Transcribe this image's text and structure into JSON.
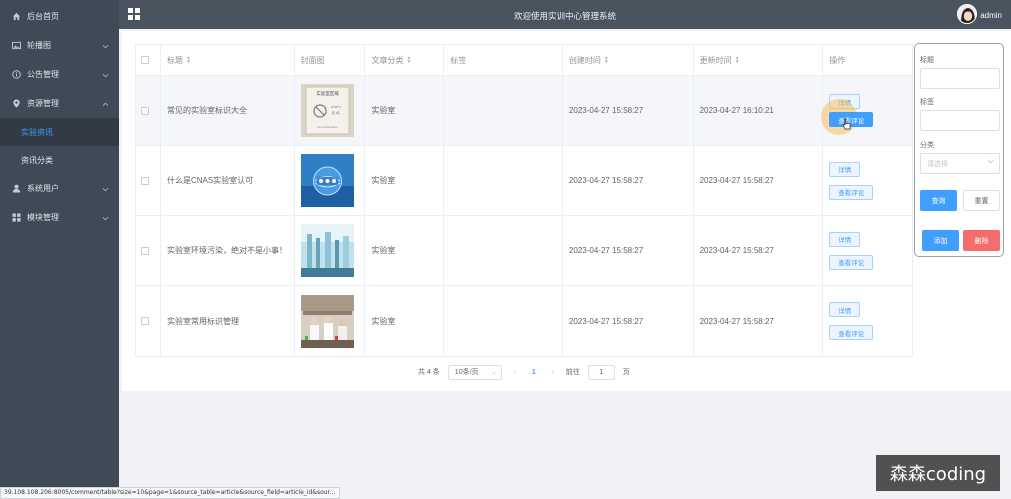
{
  "sidebar": {
    "items": [
      {
        "label": "后台首页",
        "icon": "home-icon"
      },
      {
        "label": "轮播图",
        "icon": "image-icon"
      },
      {
        "label": "公告管理",
        "icon": "info-circle-icon"
      },
      {
        "label": "资源管理",
        "icon": "location-icon",
        "expanded": true
      },
      {
        "label": "系统用户",
        "icon": "user-icon"
      },
      {
        "label": "模块管理",
        "icon": "grid-icon"
      }
    ],
    "subitems": [
      {
        "label": "实验资讯",
        "active": true
      },
      {
        "label": "资讯分类"
      }
    ]
  },
  "header": {
    "title": "欢迎使用实训中心管理系统",
    "user": "admin"
  },
  "table": {
    "columns": [
      "标题",
      "封面图",
      "文章分类",
      "标签",
      "创建时间",
      "更新时间",
      "操作"
    ],
    "rows": [
      {
        "title": "常见的实验室标识大全",
        "category": "实验室",
        "tag": "",
        "created": "2023-04-27 15:58:27",
        "updated": "2023-04-27 16:10:21",
        "cover": "sign-image"
      },
      {
        "title": "什么是CNAS实验室认可",
        "category": "实验室",
        "tag": "",
        "created": "2023-04-27 15:58:27",
        "updated": "2023-04-27 15:58:27",
        "cover": "cnas-image"
      },
      {
        "title": "实验室环境污染，绝对不是小事！",
        "category": "实验室",
        "tag": "",
        "created": "2023-04-27 15:58:27",
        "updated": "2023-04-27 15:58:27",
        "cover": "lab-equipment-image"
      },
      {
        "title": "实验室常用标识管理",
        "category": "实验室",
        "tag": "",
        "created": "2023-04-27 15:58:27",
        "updated": "2023-04-27 15:58:27",
        "cover": "lab-people-image"
      }
    ],
    "detail_label": "详情",
    "comments_label": "查看评论",
    "cover_sign_text": [
      "实验室区域",
      "A7OF 4",
      "区-1区",
      "Lave & Reindane"
    ]
  },
  "pagination": {
    "total": "共 4 条",
    "page_size": "10条/页",
    "prev": "‹",
    "current": "1",
    "next": "›",
    "goto_prefix": "前往",
    "goto_value": "1",
    "goto_suffix": "页"
  },
  "filter": {
    "title_label": "标题",
    "tag_label": "标签",
    "category_label": "分类",
    "category_placeholder": "请选择",
    "query_label": "查询",
    "reset_label": "重置",
    "add_label": "添加",
    "delete_label": "删除"
  },
  "statusbar": {
    "url": "39.108.108.206:8005/comment/table?size=10&page=1&source_table=article&source_field=article_id&sour..."
  },
  "watermark": {
    "text": "森森coding"
  },
  "colors": {
    "sidebar_bg": "#3f4a56",
    "topbar_bg": "#49545f",
    "primary": "#409eff",
    "danger": "#f56c6c"
  }
}
